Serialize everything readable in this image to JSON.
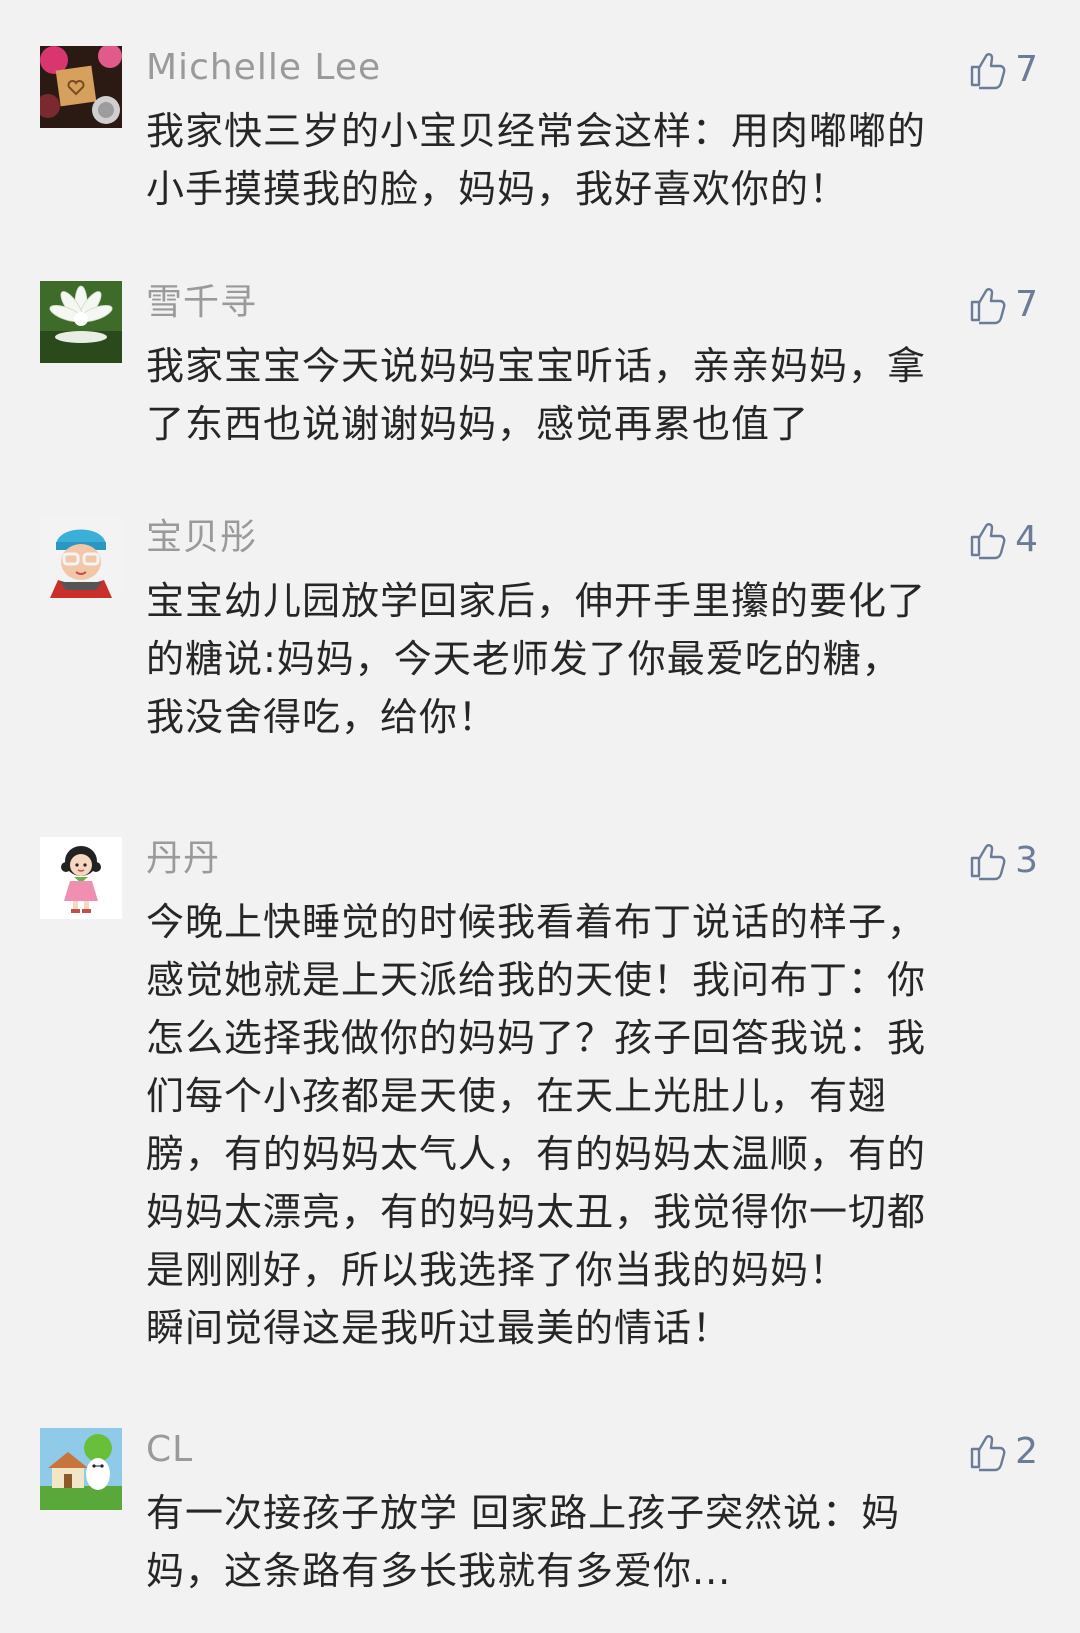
{
  "comments": [
    {
      "name": "Michelle Lee",
      "likes": "7",
      "avatar_icon": "avatar-heart-block-icon",
      "lines": [
        "我家快三岁的小宝贝经常会这样：用肉嘟嘟的",
        "小手摸摸我的脸，妈妈，我好喜欢你的！"
      ]
    },
    {
      "name": "雪千寻",
      "likes": "7",
      "avatar_icon": "avatar-white-flower-icon",
      "lines": [
        "我家宝宝今天说妈妈宝宝听话，亲亲妈妈，拿",
        "了东西也说谢谢妈妈，感觉再累也值了"
      ]
    },
    {
      "name": "宝贝彤",
      "likes": "4",
      "avatar_icon": "avatar-child-in-hat-icon",
      "lines": [
        "宝宝幼儿园放学回家后，伸开手里攥的要化了",
        "的糖说:妈妈，今天老师发了你最爱吃的糖，",
        "我没舍得吃，给你！"
      ]
    },
    {
      "name": "丹丹",
      "likes": "3",
      "avatar_icon": "avatar-cartoon-girl-icon",
      "lines": [
        "今晚上快睡觉的时候我看着布丁说话的样子，",
        "感觉她就是上天派给我的天使！我问布丁：你",
        "怎么选择我做你的妈妈了？孩子回答我说：我",
        "们每个小孩都是天使，在天上光肚儿，有翅",
        "膀，有的妈妈太气人，有的妈妈太温顺，有的",
        "妈妈太漂亮，有的妈妈太丑，我觉得你一切都",
        "是刚刚好，所以我选择了你当我的妈妈！",
        "瞬间觉得这是我听过最美的情话！"
      ]
    },
    {
      "name": "CL",
      "likes": "2",
      "avatar_icon": "avatar-cartoon-house-icon",
      "lines": [
        "有一次接孩子放学 回家路上孩子突然说：妈",
        "妈，这条路有多长我就有多爱你..."
      ]
    }
  ],
  "colors": {
    "background": "#f2f2f2",
    "name": "#9a9a9a",
    "text": "#262626",
    "like": "#6b7c99"
  }
}
